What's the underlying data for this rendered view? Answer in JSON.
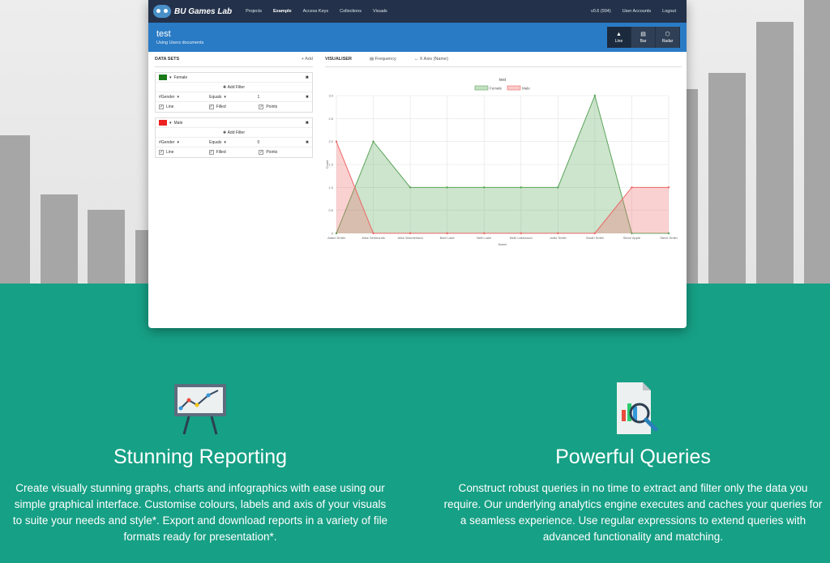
{
  "app": {
    "logo_text": "BU Games Lab",
    "nav": [
      "Projects",
      "Example",
      "Access Keys",
      "Collections",
      "Visuals"
    ],
    "nav_active": "Example",
    "nav_right": [
      "v0.6 (934)",
      "User Accounts",
      "Logout"
    ],
    "title": "test",
    "subtitle": "Using Users documents",
    "chart_types": [
      {
        "label": "Line",
        "icon": "area-chart-icon",
        "active": true
      },
      {
        "label": "Bar",
        "icon": "bar-chart-icon",
        "active": false
      },
      {
        "label": "Radar",
        "icon": "radar-chart-icon",
        "active": false
      }
    ]
  },
  "datasets_panel": {
    "title": "DATA SETS",
    "add_label": "+ Add",
    "datasets": [
      {
        "name": "Female",
        "color": "#1a7a1a",
        "add_filter": "Add Filter",
        "field": "Gender",
        "operator": "Equals",
        "value": "1",
        "options": [
          "Line",
          "Filled",
          "Points"
        ]
      },
      {
        "name": "Male",
        "color": "#ee2222",
        "add_filter": "Add Filter",
        "field": "Gender",
        "operator": "Equals",
        "value": "0",
        "options": [
          "Line",
          "Filled",
          "Points"
        ]
      }
    ]
  },
  "visualiser": {
    "title": "VISUALISER",
    "frequency": "Frequency",
    "x_axis": "X Axis (Name)"
  },
  "chart_data": {
    "type": "area",
    "title": "test",
    "xlabel": "Name",
    "ylabel": "Count",
    "categories": [
      "Adam Smith",
      "Alice Simmonds",
      "Alice Wonderland",
      "Beth Lake",
      "Beth Lake",
      "Beth Lakewood",
      "Jodie Smith",
      "Sarah Smith",
      "Steve Apple",
      "Steve Smith"
    ],
    "series": [
      {
        "name": "Female",
        "color": "#5aa55a",
        "values": [
          0,
          2,
          1,
          1,
          1,
          1,
          1,
          3,
          0,
          0
        ]
      },
      {
        "name": "Male",
        "color": "#ee6666",
        "values": [
          2,
          0,
          0,
          0,
          0,
          0,
          0,
          0,
          1,
          1
        ]
      }
    ],
    "ylim": [
      0,
      3
    ],
    "yticks": [
      "0",
      "0.5",
      "1.0",
      "1.5",
      "2.0",
      "2.5",
      "3.0"
    ],
    "grid": true,
    "legend": "top"
  },
  "features": [
    {
      "title": "Stunning Reporting",
      "text": "Create visually stunning graphs, charts and infographics with ease using our simple graphical interface. Customise colours, labels and axis of your visuals to suite your needs and style*. Export and download reports in a variety of file formats ready for presentation*.",
      "icon": "presentation-chart-icon"
    },
    {
      "title": "Powerful Queries",
      "text": "Construct robust queries in no time to extract and filter only the data you require. Our underlying analytics engine executes and caches your queries for a seamless experience. Use regular expressions to extend queries with advanced functionality and matching.",
      "icon": "document-search-icon"
    }
  ]
}
